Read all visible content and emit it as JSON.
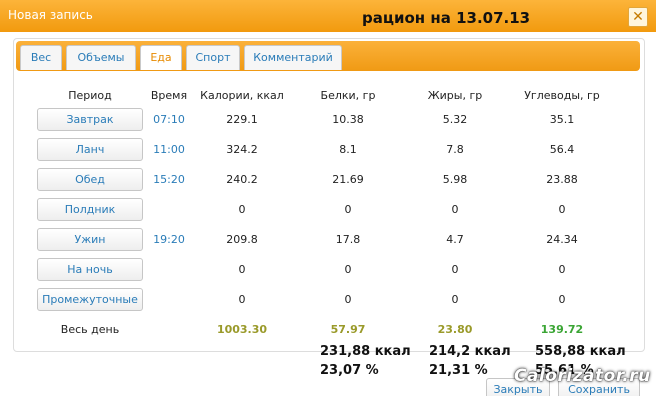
{
  "window": {
    "title": "Новая запись",
    "close_glyph": "✕"
  },
  "overlay_title": "рацион на 13.07.13",
  "tabs": [
    {
      "label": "Вес",
      "active": false
    },
    {
      "label": "Объемы",
      "active": false
    },
    {
      "label": "Еда",
      "active": true
    },
    {
      "label": "Спорт",
      "active": false
    },
    {
      "label": "Комментарий",
      "active": false
    }
  ],
  "table": {
    "headers": [
      "Период",
      "Время",
      "Калории, ккал",
      "Белки, гр",
      "Жиры, гр",
      "Углеводы, гр"
    ],
    "rows": [
      {
        "period": "Завтрак",
        "time": "07:10",
        "cal": "229.1",
        "prot": "10.38",
        "fat": "5.32",
        "carb": "35.1"
      },
      {
        "period": "Ланч",
        "time": "11:00",
        "cal": "324.2",
        "prot": "8.1",
        "fat": "7.8",
        "carb": "56.4"
      },
      {
        "period": "Обед",
        "time": "15:20",
        "cal": "240.2",
        "prot": "21.69",
        "fat": "5.98",
        "carb": "23.88"
      },
      {
        "period": "Полдник",
        "time": "",
        "cal": "0",
        "prot": "0",
        "fat": "0",
        "carb": "0"
      },
      {
        "period": "Ужин",
        "time": "19:20",
        "cal": "209.8",
        "prot": "17.8",
        "fat": "4.7",
        "carb": "24.34"
      },
      {
        "period": "На ночь",
        "time": "",
        "cal": "0",
        "prot": "0",
        "fat": "0",
        "carb": "0"
      },
      {
        "period": "Промежуточные",
        "time": "",
        "cal": "0",
        "prot": "0",
        "fat": "0",
        "carb": "0"
      }
    ],
    "total": {
      "label": "Весь день",
      "cal": "1003.30",
      "prot": "57.97",
      "fat": "23.80",
      "carb": "139.72"
    }
  },
  "annotations": {
    "prot_kcal": "231,88 ккал",
    "prot_pct": "23,07 %",
    "fat_kcal": "214,2 ккал",
    "fat_pct": "21,31 %",
    "carb_kcal": "558,88 ккал",
    "carb_pct": "55,61 %"
  },
  "footer": {
    "close_label": "Закрыть",
    "save_label": "Сохранить"
  },
  "watermark": "Calorizator.ru",
  "colors": {
    "accent": "#f5a623",
    "link": "#2a7cb8",
    "active_tab_text": "#e78a00",
    "total_olive": "#9a9a2a",
    "total_green": "#3aa534"
  }
}
